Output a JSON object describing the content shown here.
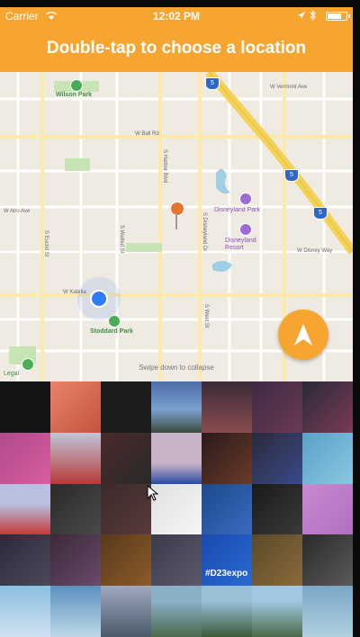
{
  "status_bar": {
    "carrier": "Carrier",
    "time": "12:02 PM",
    "battery_level": 0.8
  },
  "banner": {
    "title": "Double-tap to choose a location"
  },
  "map": {
    "street_labels": {
      "w_ball_rd": "W Ball Rd",
      "w_vermont_ave": "W Vermont Ave",
      "w_alro": "W Alro Ave",
      "w_disney_way": "W Disney Way",
      "w_katella": "W Katella",
      "s_harbor": "S Harbor Blvd",
      "s_walnut": "S Walnut St",
      "s_disneyland_dr": "S Disneyland Dr",
      "s_west_st": "S West St",
      "s_euclid": "S Euclid St"
    },
    "parks": [
      "Wilson Park",
      "Stoddard Park"
    ],
    "pois": [
      "Disneyland Park",
      "Disneyland Resort"
    ],
    "highways": [
      "5",
      "5",
      "5"
    ],
    "legal": "Swipe down to collapse",
    "legal_left": "Legal"
  },
  "photo_tiles": {
    "expo_caption": "#D23expo"
  },
  "colors": {
    "accent": "#f6a630",
    "map_bg": "#efeae2",
    "road_major": "#f7dc6f",
    "user_location": "#2f7df6"
  },
  "icons": {
    "wifi": "wifi-icon",
    "battery": "battery-icon",
    "locate": "location-arrow-icon",
    "pin": "map-pin-icon"
  }
}
